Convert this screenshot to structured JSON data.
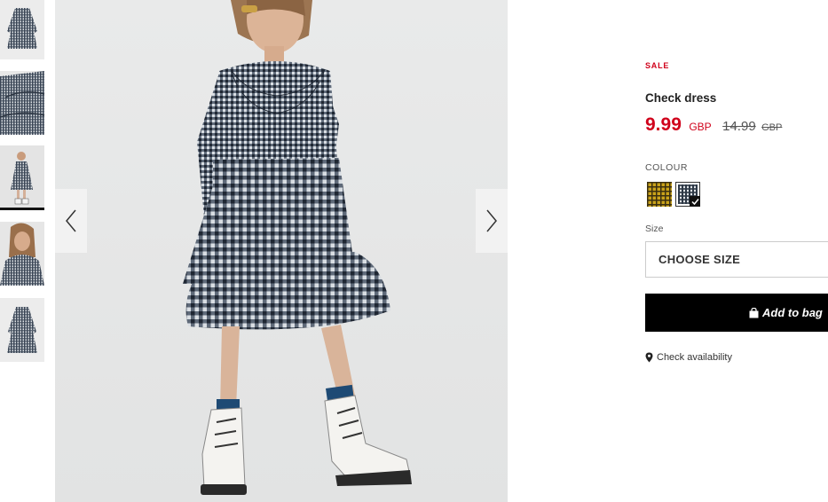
{
  "gallery": {
    "thumbnails": [
      {
        "alt": "dress-front-thumbnail"
      },
      {
        "alt": "dress-detail-thumbnail"
      },
      {
        "alt": "model-full-thumbnail"
      },
      {
        "alt": "model-closeup-thumbnail"
      },
      {
        "alt": "dress-back-thumbnail"
      }
    ],
    "active_index": 2,
    "prev_icon": "chevron-left-icon",
    "next_icon": "chevron-right-icon"
  },
  "product": {
    "badge": "SALE",
    "title": "Check dress",
    "price": "9.99",
    "currency": "GBP",
    "old_price": "14.99",
    "old_currency": "GBP"
  },
  "colour": {
    "label": "COLOUR",
    "swatches": [
      {
        "name": "yellow-check",
        "color": "#c9a21a",
        "selected": false
      },
      {
        "name": "navy-check",
        "color": "#2d3846",
        "selected": true
      }
    ]
  },
  "size": {
    "label": "Size",
    "placeholder": "CHOOSE SIZE"
  },
  "actions": {
    "add_to_bag": "Add to bag",
    "check_availability": "Check availability"
  },
  "colors": {
    "sale_red": "#d0021b",
    "button_black": "#000000"
  }
}
